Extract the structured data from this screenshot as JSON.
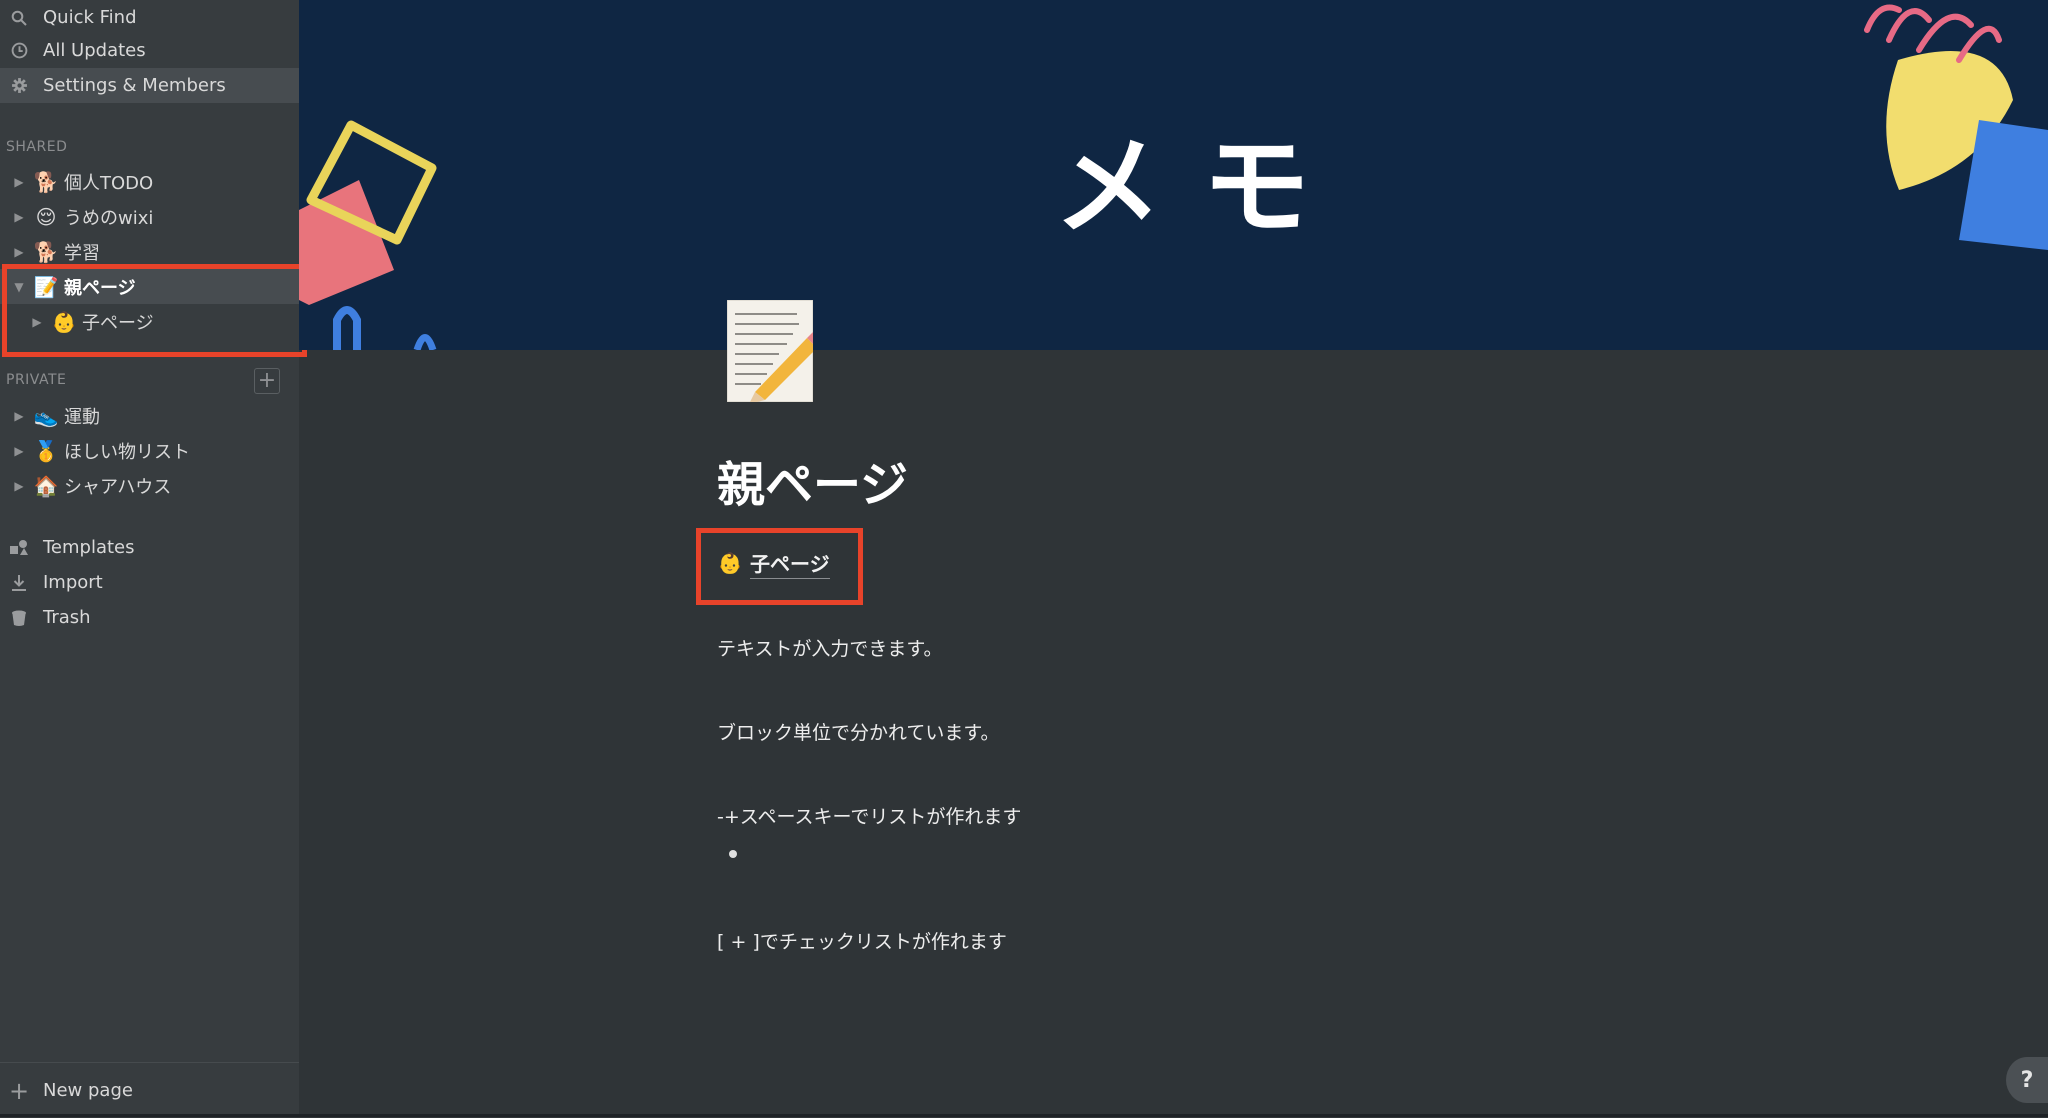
{
  "sidebar": {
    "nav": [
      {
        "label": "Quick Find",
        "icon": "search-icon"
      },
      {
        "label": "All Updates",
        "icon": "clock-icon"
      },
      {
        "label": "Settings & Members",
        "icon": "gear-icon"
      }
    ],
    "shared_heading": "SHARED",
    "shared": [
      {
        "label": "個人TODO",
        "emoji": "🐕"
      },
      {
        "label": "うめのwixi",
        "emoji": "😌"
      },
      {
        "label": "学習",
        "emoji": "🐕"
      },
      {
        "label": "親ページ",
        "emoji": "📝"
      },
      {
        "label": "子ページ",
        "emoji": "👶"
      }
    ],
    "private_heading": "PRIVATE",
    "add_symbol": "+",
    "private": [
      {
        "label": "運動",
        "emoji": "👟"
      },
      {
        "label": "ほしい物リスト",
        "emoji": "🥇"
      },
      {
        "label": "シャアハウス",
        "emoji": "🏠"
      }
    ],
    "tools": [
      {
        "label": "Templates",
        "icon": "templates-icon"
      },
      {
        "label": "Import",
        "icon": "import-icon"
      },
      {
        "label": "Trash",
        "icon": "trash-icon"
      }
    ],
    "new_page": "New page"
  },
  "main": {
    "cover_text": "メモ",
    "page_title": "親ページ",
    "child_page": {
      "label": "子ページ",
      "emoji": "👶"
    },
    "blocks": [
      "テキストが入力できます。",
      "ブロック単位で分かれています。",
      "-+スペースキーでリストが作れます",
      "[ + ]でチェックリストが作れます"
    ],
    "help": "?"
  },
  "colors": {
    "highlight": "#e8432a",
    "cover": "#0f2643",
    "sidebar": "#373c3f",
    "content": "#2f3437"
  }
}
